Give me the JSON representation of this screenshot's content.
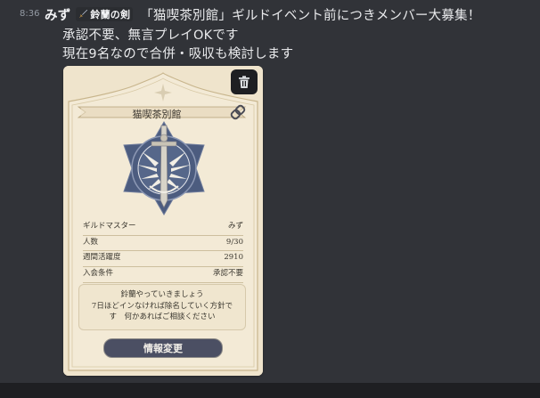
{
  "message": {
    "timestamp": "8:36",
    "author": "みず",
    "guild_tag": "鈴蘭の剣",
    "lines": [
      "「猫喫茶別館」ギルドイベント前につきメンバー大募集！",
      "承認不要、無言プレイOKです",
      "現在9名なので合併・吸収も検討します"
    ]
  },
  "card": {
    "guild_name": "猫喫茶別館",
    "stats": [
      {
        "label": "ギルドマスター",
        "value": "みず"
      },
      {
        "label": "人数",
        "value": "9/30"
      },
      {
        "label": "週間活躍度",
        "value": "2910"
      },
      {
        "label": "入会条件",
        "value": "承認不要"
      }
    ],
    "description": [
      "鈴蘭やっていきましょう",
      "7日ほどインなければ除名していく方針で",
      "す　何かあればご相談ください"
    ],
    "button_label": "情報変更"
  },
  "icons": {
    "delete": "trash-icon",
    "link": "chain-link-icon",
    "emblem": "sword-crest-icon",
    "tag": "sword-icon"
  },
  "colors": {
    "background": "#313338",
    "card": "#efe4cc",
    "emblem_blue": "#4c5c7f",
    "button": "#4b4f63"
  }
}
